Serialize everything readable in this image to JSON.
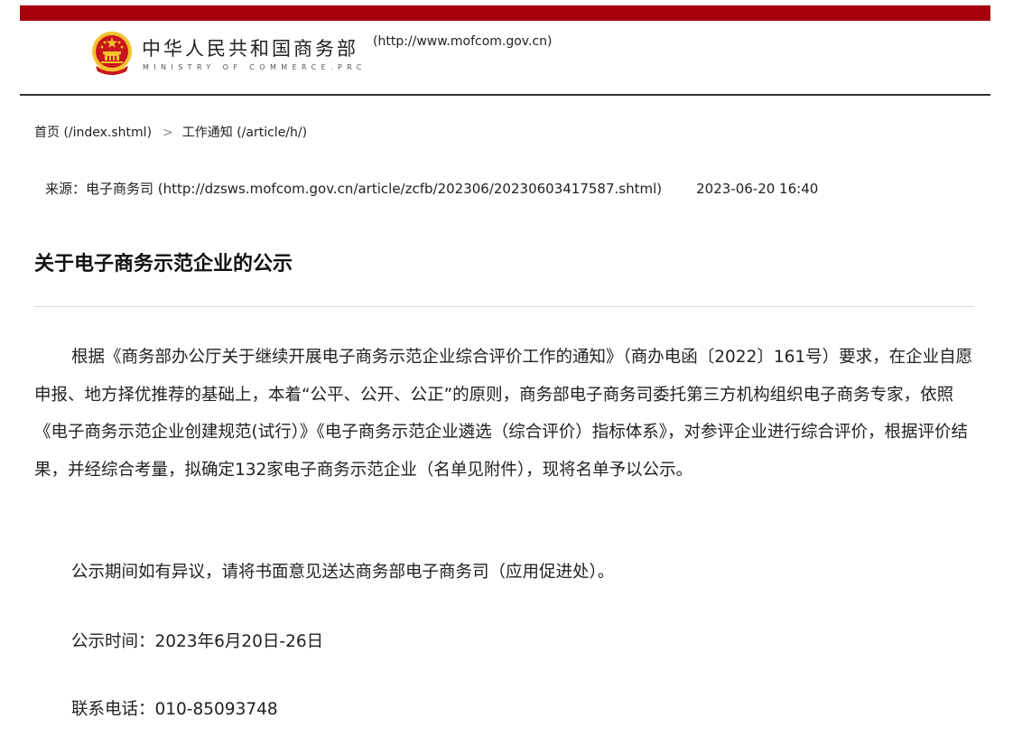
{
  "header": {
    "ministry_name_cn": "中华人民共和国商务部",
    "site_url": "(http://www.mofcom.gov.cn)",
    "ministry_name_en": "MINISTRY OF COMMERCE.PRC"
  },
  "breadcrumb": {
    "home": "首页 (/index.shtml)",
    "separator": ">",
    "section": "工作通知 (/article/h/)"
  },
  "meta": {
    "source": "来源：电子商务司 (http://dzsws.mofcom.gov.cn/article/zcfb/202306/20230603417587.shtml)",
    "date": "2023-06-20 16:40"
  },
  "article": {
    "title": "关于电子商务示范企业的公示",
    "paragraph_1": "根据《商务部办公厅关于继续开展电子商务示范企业综合评价工作的通知》（商办电函〔2022〕161号）要求，在企业自愿申报、地方择优推荐的基础上，本着“公平、公开、公正”的原则，商务部电子商务司委托第三方机构组织电子商务专家，依照《电子商务示范企业创建规范(试行）》《电子商务示范企业遴选（综合评价）指标体系》，对参评企业进行综合评价，根据评价结果，并经综合考量，拟确定132家电子商务示范企业（名单见附件），现将名单予以公示。",
    "paragraph_2": "公示期间如有异议，请将书面意见送达商务部电子商务司（应用促进处）。",
    "paragraph_3": "公示时间：2023年6月20日-26日",
    "paragraph_4": "联系电话：010-85093748"
  },
  "colors": {
    "topbar": "#a6000d",
    "emblem_red": "#c8161d",
    "emblem_gold": "#f2c230"
  },
  "icons": {
    "emblem": "national-emblem-icon"
  }
}
